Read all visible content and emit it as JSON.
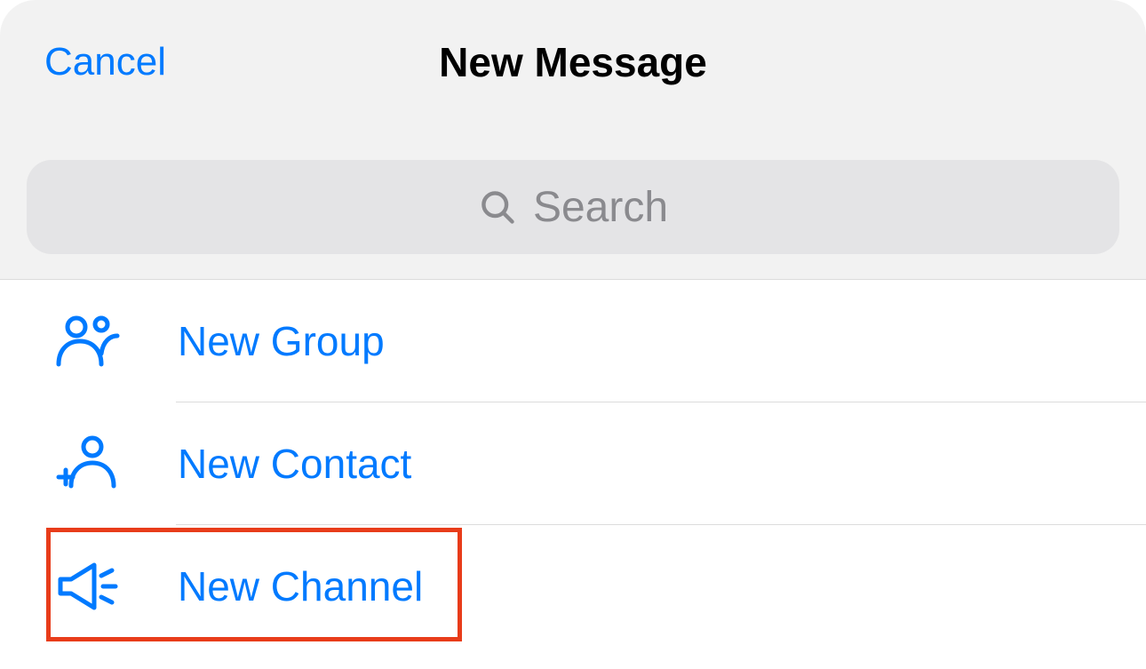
{
  "header": {
    "cancel_label": "Cancel",
    "title": "New Message"
  },
  "search": {
    "placeholder": "Search"
  },
  "options": {
    "new_group": "New Group",
    "new_contact": "New Contact",
    "new_channel": "New Channel"
  },
  "colors": {
    "accent": "#007aff",
    "header_bg": "#f2f2f2",
    "search_bg": "#e4e4e6",
    "placeholder": "#8a8a8e",
    "highlight": "#e83c1a"
  }
}
